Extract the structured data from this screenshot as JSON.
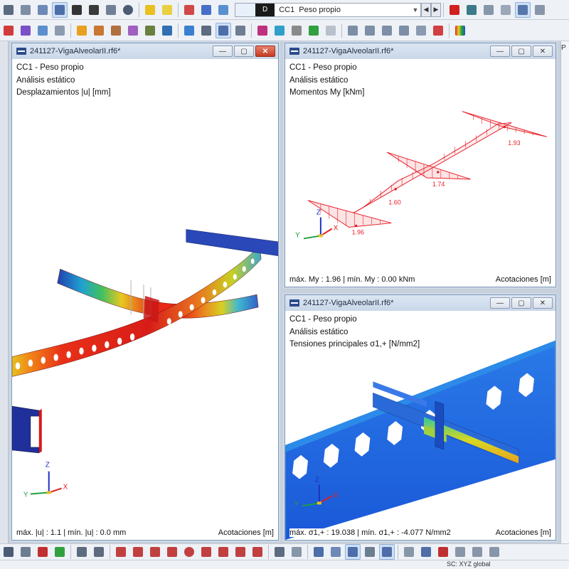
{
  "toolbar": {
    "loadcase_tag": "",
    "loadcase_letter": "D",
    "loadcase_code": "CC1",
    "loadcase_name": "Peso propio"
  },
  "windows": {
    "displacement": {
      "title": "241127-VigaAlveolarII.rf6*",
      "case": "CC1 - Peso propio",
      "analysis": "Análisis estático",
      "result": "Desplazamientos |u| [mm]",
      "footer_left": "máx. |u| : 1.1 | mín. |u| : 0.0 mm",
      "footer_right": "Acotaciones [m]"
    },
    "moments": {
      "title": "241127-VigaAlveolarII.rf6*",
      "case": "CC1 - Peso propio",
      "analysis": "Análisis estático",
      "result": "Momentos My [kNm]",
      "footer_left": "máx. My : 1.96 | mín. My : 0.00 kNm",
      "footer_right": "Acotaciones [m]",
      "values": [
        "1.93",
        "1.74",
        "1.60",
        "1.96"
      ]
    },
    "stresses": {
      "title": "241127-VigaAlveolarII.rf6*",
      "case": "CC1 - Peso propio",
      "analysis": "Análisis estático",
      "result": "Tensiones principales σ1,+ [N/mm2]",
      "footer_left": "máx. σ1,+ : 19.038 | mín. σ1,+ : -4.077 N/mm2",
      "footer_right": "Acotaciones [m]"
    }
  },
  "axes": {
    "x": "X",
    "y": "Y",
    "z": "Z"
  },
  "side_panel": {
    "label": "P"
  },
  "status_bar": {
    "coord_system": "SC: XYZ global"
  },
  "colors": {
    "moment_diagram": "#e8202a",
    "accent": "#2b4b8c",
    "window_close": "#c63b24"
  }
}
